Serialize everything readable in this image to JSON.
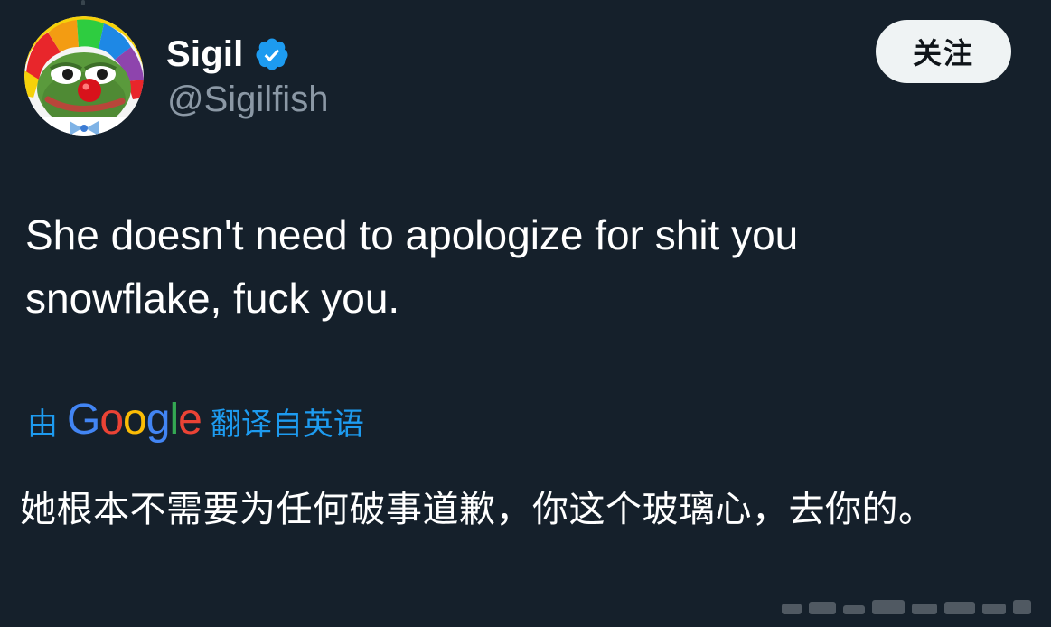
{
  "user": {
    "display_name": "Sigil",
    "handle": "@Sigilfish",
    "verified": true,
    "avatar_icon": "clown-frog-avatar"
  },
  "header": {
    "follow_label": "关注"
  },
  "tweet": {
    "text": "She doesn't need to apologize for shit you snowflake, fuck you."
  },
  "translation": {
    "by_label": "由",
    "provider": "Google",
    "from_label": "翻译自英语",
    "text": "她根本不需要为任何破事道歉，你这个玻璃心，去你的。"
  },
  "colors": {
    "background": "#15202b",
    "text_primary": "#ffffff",
    "text_secondary": "#8b98a5",
    "accent": "#1d9bf0",
    "button_bg": "#eff3f4",
    "button_text": "#0f1419"
  }
}
